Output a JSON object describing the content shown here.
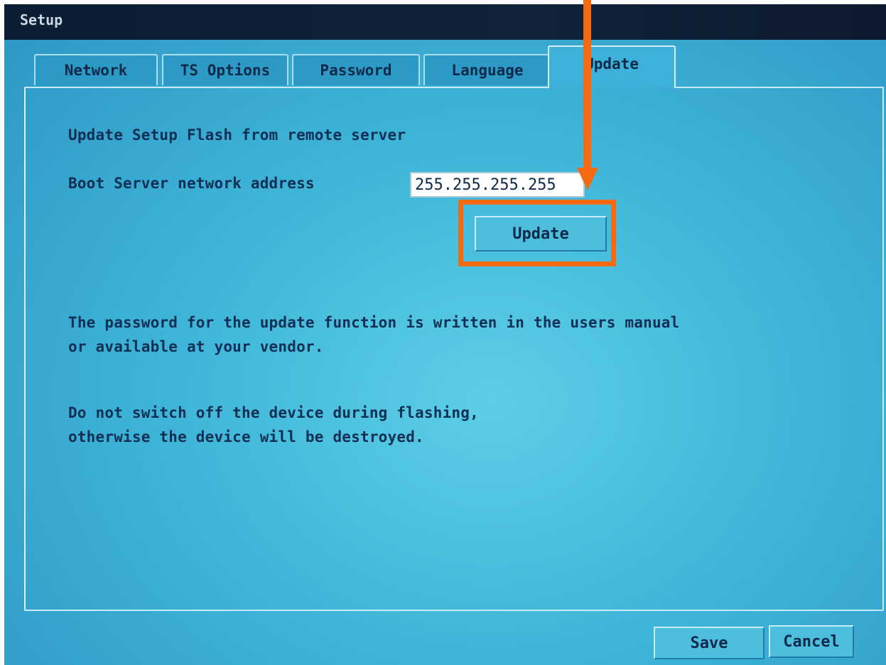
{
  "window": {
    "title": "Setup"
  },
  "tabs": [
    {
      "label": "Network",
      "active": false
    },
    {
      "label": "TS Options",
      "active": false
    },
    {
      "label": "Password",
      "active": false
    },
    {
      "label": "Language",
      "active": false
    },
    {
      "label": "Update",
      "active": true
    }
  ],
  "update_panel": {
    "heading": "Update Setup Flash from remote server",
    "boot_server_label": "Boot Server network address",
    "boot_server_value": "255.255.255.255",
    "update_button": "Update",
    "password_note_line1": "The password for the update function is written in the users manual",
    "password_note_line2": "or available at your vendor.",
    "warning_line1": "Do not switch off the device during flashing,",
    "warning_line2": "otherwise the device will be destroyed."
  },
  "footer": {
    "save_button": "Save",
    "cancel_button": "Cancel"
  },
  "annotation": {
    "highlight_color": "#f36a12",
    "arrow_icon": "down-arrow-icon"
  },
  "colors": {
    "background": "#3fb6d9",
    "titlebar": "#0b1d33",
    "text": "#0f2f54"
  }
}
